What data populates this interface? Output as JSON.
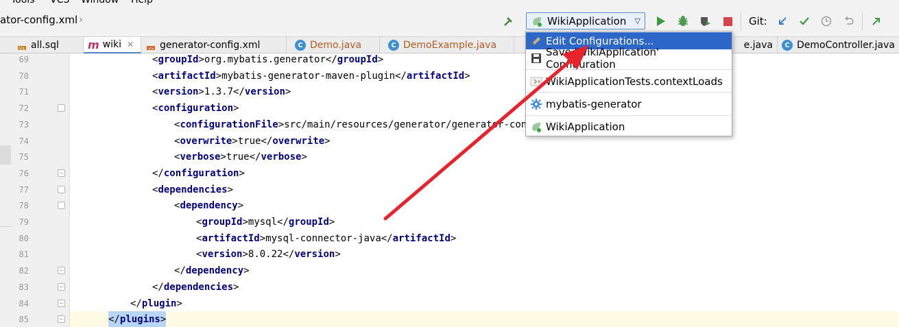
{
  "menu": {
    "items": [
      "Tools",
      "VCS",
      "Window",
      "Help"
    ]
  },
  "breadcrumb": {
    "file": "ator-config.xml"
  },
  "toolbar": {
    "run_config_label": "WikiApplication",
    "git_label": "Git:"
  },
  "tabs": [
    {
      "label": "all.sql",
      "icon": "sql-icon",
      "active": false
    },
    {
      "label": "wiki",
      "icon": "maven-icon",
      "active": true
    },
    {
      "label": "generator-config.xml",
      "icon": "xml-icon",
      "active": false
    },
    {
      "label": "Demo.java",
      "icon": "class-icon",
      "active": false,
      "color": "#b35a1f"
    },
    {
      "label": "DemoExample.java",
      "icon": "class-icon",
      "active": false,
      "color": "#b35a1f"
    },
    {
      "label": "e.java",
      "icon": "class-icon",
      "active": false
    },
    {
      "label": "DemoController.java",
      "icon": "class-icon",
      "active": false
    }
  ],
  "code_lines": [
    {
      "num": "69",
      "indent": 0,
      "parts": [
        [
          "br",
          "<"
        ],
        [
          "tag",
          "groupId"
        ],
        [
          "br",
          ">"
        ],
        [
          "txt",
          "org.mybatis.generator"
        ],
        [
          "br",
          "</"
        ],
        [
          "tag",
          "groupId"
        ],
        [
          "br",
          ">"
        ]
      ]
    },
    {
      "num": "70",
      "indent": 0,
      "parts": [
        [
          "br",
          "<"
        ],
        [
          "tag",
          "artifactId"
        ],
        [
          "br",
          ">"
        ],
        [
          "txt",
          "mybatis-generator-maven-plugin"
        ],
        [
          "br",
          "</"
        ],
        [
          "tag",
          "artifactId"
        ],
        [
          "br",
          ">"
        ]
      ]
    },
    {
      "num": "71",
      "indent": 0,
      "parts": [
        [
          "br",
          "<"
        ],
        [
          "tag",
          "version"
        ],
        [
          "br",
          ">"
        ],
        [
          "txt",
          "1.3.7"
        ],
        [
          "br",
          "</"
        ],
        [
          "tag",
          "version"
        ],
        [
          "br",
          ">"
        ]
      ]
    },
    {
      "num": "72",
      "indent": 0,
      "parts": [
        [
          "br",
          "<"
        ],
        [
          "tag",
          "configuration"
        ],
        [
          "br",
          ">"
        ]
      ]
    },
    {
      "num": "73",
      "indent": 1,
      "parts": [
        [
          "br",
          "<"
        ],
        [
          "tag",
          "configurationFile"
        ],
        [
          "br",
          ">"
        ],
        [
          "txt",
          "src/main/resources/generator/generator-conf"
        ]
      ]
    },
    {
      "num": "74",
      "indent": 1,
      "parts": [
        [
          "br",
          "<"
        ],
        [
          "tag",
          "overwrite"
        ],
        [
          "br",
          ">"
        ],
        [
          "txt",
          "true"
        ],
        [
          "br",
          "</"
        ],
        [
          "tag",
          "overwrite"
        ],
        [
          "br",
          ">"
        ]
      ]
    },
    {
      "num": "75",
      "indent": 1,
      "parts": [
        [
          "br",
          "<"
        ],
        [
          "tag",
          "verbose"
        ],
        [
          "br",
          ">"
        ],
        [
          "txt",
          "true"
        ],
        [
          "br",
          "</"
        ],
        [
          "tag",
          "verbose"
        ],
        [
          "br",
          ">"
        ]
      ]
    },
    {
      "num": "76",
      "indent": 0,
      "parts": [
        [
          "br",
          "</"
        ],
        [
          "tag",
          "configuration"
        ],
        [
          "br",
          ">"
        ]
      ]
    },
    {
      "num": "77",
      "indent": 0,
      "parts": [
        [
          "br",
          "<"
        ],
        [
          "tag",
          "dependencies"
        ],
        [
          "br",
          ">"
        ]
      ]
    },
    {
      "num": "78",
      "indent": 1,
      "parts": [
        [
          "br",
          "<"
        ],
        [
          "tag",
          "dependency"
        ],
        [
          "br",
          ">"
        ]
      ]
    },
    {
      "num": "79",
      "indent": 2,
      "parts": [
        [
          "br",
          "<"
        ],
        [
          "tag",
          "groupId"
        ],
        [
          "br",
          ">"
        ],
        [
          "txt",
          "mysql"
        ],
        [
          "br",
          "</"
        ],
        [
          "tag",
          "groupId"
        ],
        [
          "br",
          ">"
        ]
      ]
    },
    {
      "num": "80",
      "indent": 2,
      "parts": [
        [
          "br",
          "<"
        ],
        [
          "tag",
          "artifactId"
        ],
        [
          "br",
          ">"
        ],
        [
          "txt",
          "mysql-connector-java"
        ],
        [
          "br",
          "</"
        ],
        [
          "tag",
          "artifactId"
        ],
        [
          "br",
          ">"
        ]
      ]
    },
    {
      "num": "81",
      "indent": 2,
      "parts": [
        [
          "br",
          "<"
        ],
        [
          "tag",
          "version"
        ],
        [
          "br",
          ">"
        ],
        [
          "txt",
          "8.0.22"
        ],
        [
          "br",
          "</"
        ],
        [
          "tag",
          "version"
        ],
        [
          "br",
          ">"
        ]
      ]
    },
    {
      "num": "82",
      "indent": 1,
      "parts": [
        [
          "br",
          "</"
        ],
        [
          "tag",
          "dependency"
        ],
        [
          "br",
          ">"
        ]
      ]
    },
    {
      "num": "83",
      "indent": 0,
      "parts": [
        [
          "br",
          "</"
        ],
        [
          "tag",
          "dependencies"
        ],
        [
          "br",
          ">"
        ]
      ]
    },
    {
      "num": "84",
      "indent": -1,
      "parts": [
        [
          "br",
          "</"
        ],
        [
          "tag",
          "plugin"
        ],
        [
          "br",
          ">"
        ]
      ]
    },
    {
      "num": "85",
      "indent": -2,
      "parts": [
        [
          "br",
          "</"
        ],
        [
          "tag",
          "plugins"
        ],
        [
          "br",
          ">"
        ]
      ]
    }
  ],
  "popup": {
    "items": [
      {
        "label": "Edit Configurations...",
        "icon": "edit-icon",
        "selected": true
      },
      {
        "label": "Save 'WikiApplication' Configuration",
        "icon": "save-icon",
        "selected": false
      },
      {
        "label": "WikiApplicationTests.contextLoads",
        "icon": "test-icon",
        "selected": false
      },
      {
        "label": "mybatis-generator",
        "icon": "gear-icon",
        "selected": false
      },
      {
        "label": "WikiApplication",
        "icon": "spring-icon",
        "selected": false
      }
    ]
  },
  "colors": {
    "accent": "#2d67c8",
    "arrow": "#e8232c",
    "tag": "#000080"
  }
}
